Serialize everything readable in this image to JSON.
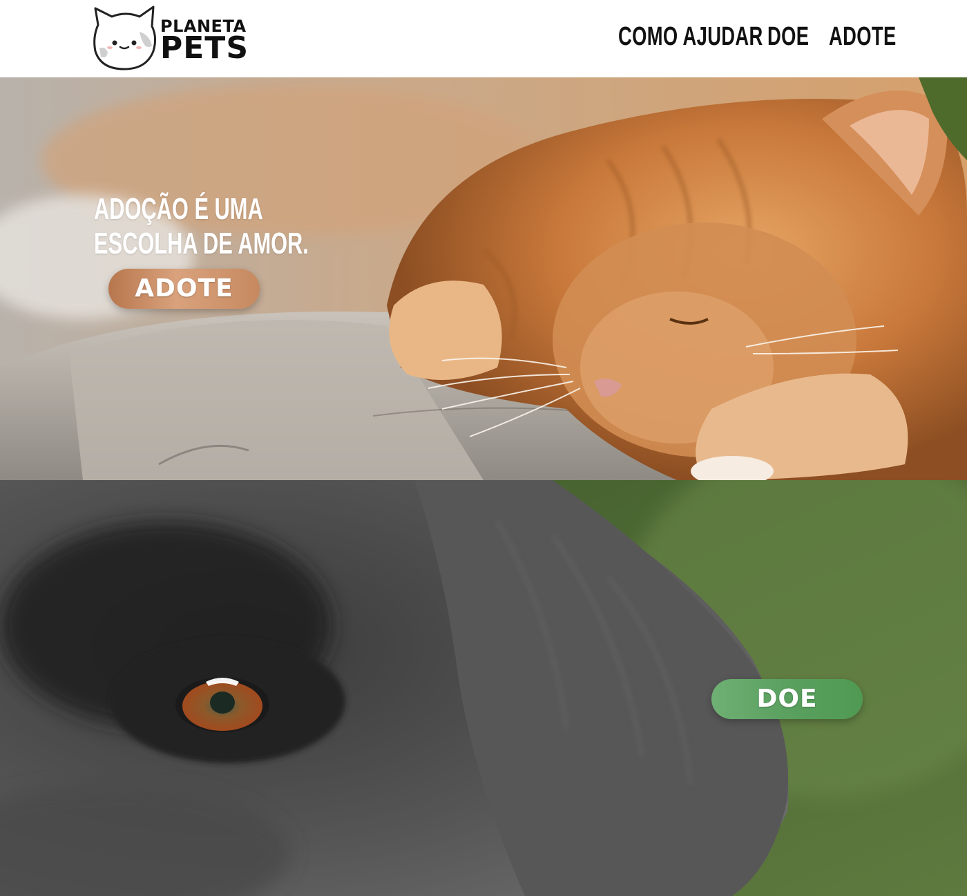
{
  "brand": {
    "line1": "PLANETA",
    "line2": "PETS"
  },
  "nav": {
    "items": [
      {
        "label": "COMO AJUDAR"
      },
      {
        "label": "DOE"
      },
      {
        "label": "ADOTE"
      }
    ]
  },
  "hero_cat": {
    "headline_line1": "ADOÇÃO É UMA",
    "headline_line2": "ESCOLHA DE AMOR.",
    "button_label": "ADOTE",
    "button_color": "#c68960"
  },
  "hero_dog": {
    "button_label": "DOE",
    "button_color": "#5aa05f"
  }
}
